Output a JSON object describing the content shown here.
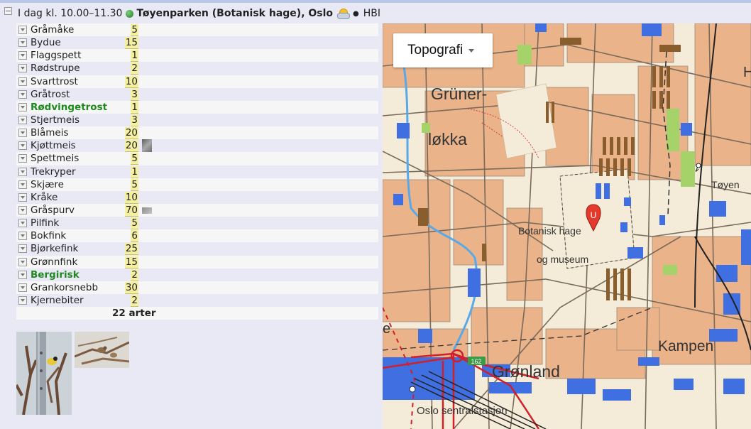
{
  "header": {
    "time_label": "I dag kl. 10.00–11.30",
    "location": "Tøyenparken (Botanisk hage), Oslo",
    "observer": "HBI"
  },
  "species": [
    {
      "name": "Gråmåke",
      "count": "5"
    },
    {
      "name": "Bydue",
      "count": "15"
    },
    {
      "name": "Flaggspett",
      "count": "1"
    },
    {
      "name": "Rødstrupe",
      "count": "2"
    },
    {
      "name": "Svarttrost",
      "count": "10"
    },
    {
      "name": "Gråtrost",
      "count": "3"
    },
    {
      "name": "Rødvingetrost",
      "count": "1",
      "highlight": true
    },
    {
      "name": "Stjertmeis",
      "count": "3"
    },
    {
      "name": "Blåmeis",
      "count": "20"
    },
    {
      "name": "Kjøttmeis",
      "count": "20",
      "photo": "tall"
    },
    {
      "name": "Spettmeis",
      "count": "5"
    },
    {
      "name": "Trekryper",
      "count": "1"
    },
    {
      "name": "Skjære",
      "count": "5"
    },
    {
      "name": "Kråke",
      "count": "10"
    },
    {
      "name": "Gråspurv",
      "count": "70",
      "photo": "wide"
    },
    {
      "name": "Pilfink",
      "count": "5"
    },
    {
      "name": "Bokfink",
      "count": "6"
    },
    {
      "name": "Bjørkefink",
      "count": "25"
    },
    {
      "name": "Grønnfink",
      "count": "15"
    },
    {
      "name": "Bergirisk",
      "count": "2",
      "highlight": true
    },
    {
      "name": "Grankorsnebb",
      "count": "30"
    },
    {
      "name": "Kjernebiter",
      "count": "2"
    }
  ],
  "total_label": "22 arter",
  "map": {
    "layer_button": "Topografi",
    "labels": {
      "grunerlokka_1": "Grüner-",
      "grunerlokka_2": "løkka",
      "botanisk_1": "Botanisk hage",
      "botanisk_2": "og museum",
      "gronland": "Grønland",
      "kampen": "Kampen",
      "toyen": "Tøyen",
      "sentralstasjon": "Oslo sentralstasjon",
      "road_number": "162",
      "edge_h": "H",
      "edge_e": "e",
      "marker_letter": "U"
    },
    "colors": {
      "background": "#f4ecd8",
      "block": "#eab38a",
      "building": "#3f6fe0",
      "park": "#a6d26a",
      "road": "#7a6a5a",
      "rail": "#222222",
      "red_road": "#d0202a",
      "water": "#59a9e8",
      "marker": "#e23b2e"
    }
  },
  "colors": {
    "highlight_name": "#1e8a1e",
    "count_bg": "#f5f0a0",
    "row_light": "#f6f6f6",
    "row_dark": "#e9e9f6"
  }
}
